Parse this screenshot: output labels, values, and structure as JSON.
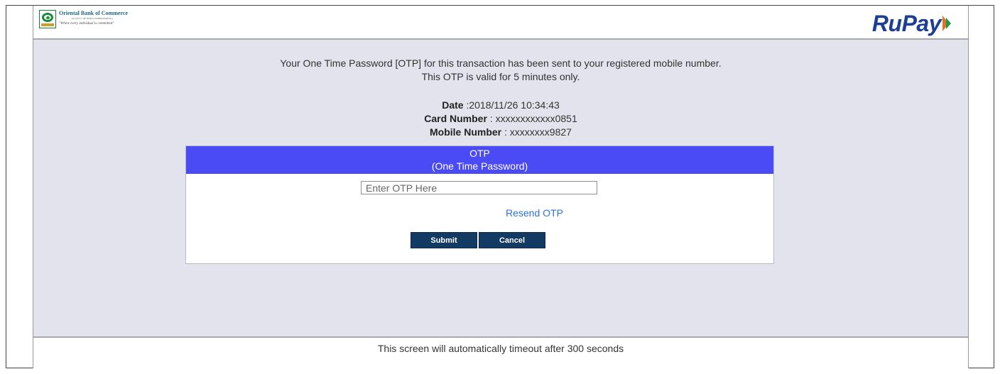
{
  "header": {
    "bank_name": "Oriental Bank of Commerce",
    "bank_subtitle": "(A GOVT. OF INDIA UNDERTAKING)",
    "bank_tagline": "\"Where every individual is committed\"",
    "network_logo": "RuPay"
  },
  "message": {
    "line1": "Your One Time Password [OTP] for this transaction has been sent to your registered mobile number.",
    "line2": "This OTP is valid for 5 minutes only."
  },
  "details": {
    "date_label": "Date",
    "date_value": " :2018/11/26 10:34:43",
    "card_label": "Card Number",
    "card_value": " : xxxxxxxxxxxx0851",
    "mobile_label": "Mobile Number",
    "mobile_value": " : xxxxxxxx9827"
  },
  "otp": {
    "title": "OTP",
    "subtitle": "(One Time Password)",
    "input_placeholder": "Enter OTP Here",
    "input_value": "",
    "resend_label": "Resend OTP",
    "submit_label": "Submit",
    "cancel_label": "Cancel"
  },
  "footer": {
    "timeout_text": "This screen will automatically timeout after 300 seconds"
  },
  "colors": {
    "otp_header": "#4b4bf5",
    "button": "#123a62",
    "link": "#2a72d8",
    "page_bg": "#e2e3ec",
    "rupay_blue": "#1c3f94",
    "rupay_orange": "#e8731c",
    "rupay_green": "#1a9a4a"
  }
}
